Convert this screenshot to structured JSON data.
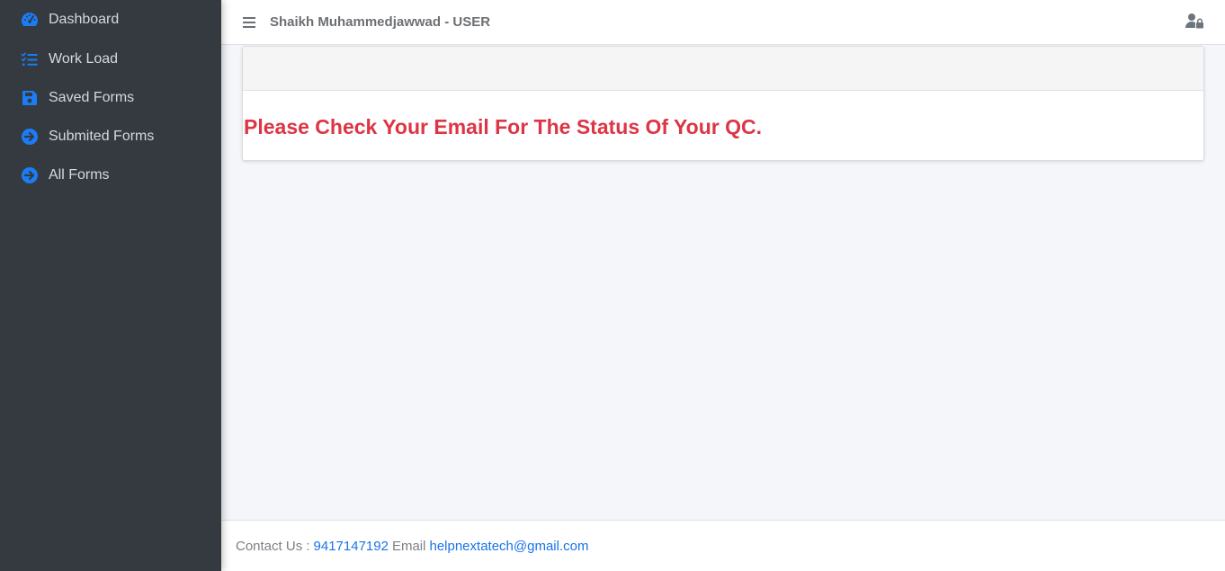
{
  "sidebar": {
    "items": [
      {
        "label": "Dashboard",
        "icon": "tachometer-icon"
      },
      {
        "label": "Work Load",
        "icon": "list-check-icon"
      },
      {
        "label": "Saved Forms",
        "icon": "save-icon"
      },
      {
        "label": "Submited Forms",
        "icon": "arrow-circle-right-icon"
      },
      {
        "label": "All Forms",
        "icon": "arrow-circle-right-icon"
      }
    ]
  },
  "header": {
    "title": "Shaikh Muhammedjawwad - USER"
  },
  "main": {
    "message": "Please Check Your Email For The Status Of Your QC."
  },
  "footer": {
    "contact_label": "Contact Us :",
    "phone": "9417147192",
    "email_label": "Email",
    "email": "helpnextatech@gmail.com"
  },
  "colors": {
    "sidebar_bg": "#343a40",
    "icon_accent": "#007bff",
    "message_red": "#dc3545",
    "link_blue": "#1a73e8"
  }
}
